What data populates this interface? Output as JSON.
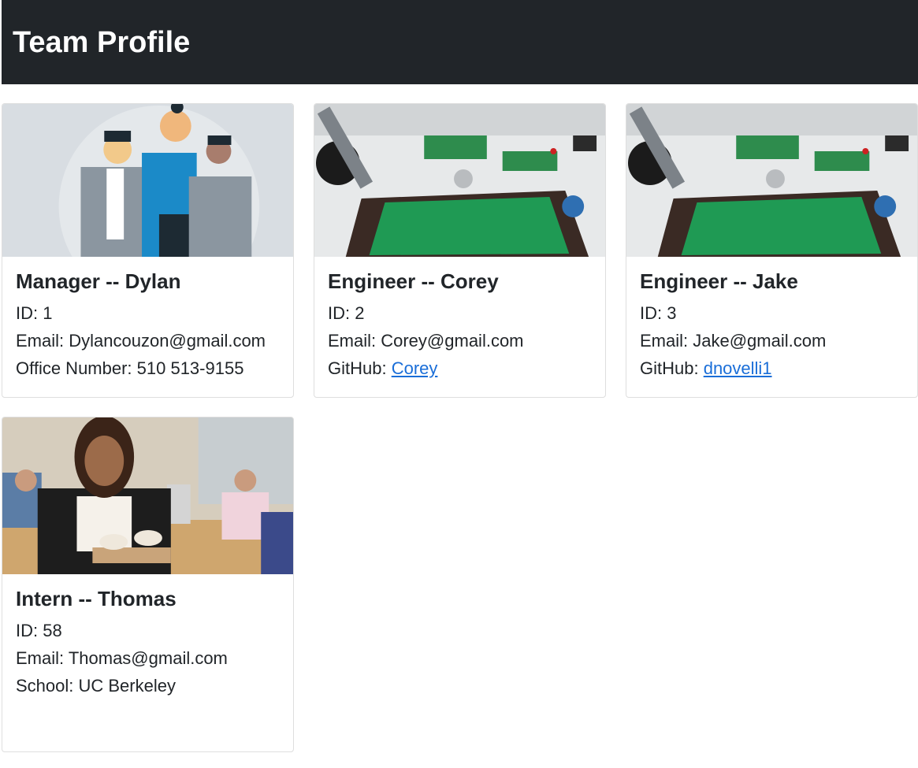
{
  "header": {
    "title": "Team Profile"
  },
  "cards": [
    {
      "image": "team-illustration",
      "title": "Manager -- Dylan",
      "id_label": "ID: 1",
      "email_label": "Email: Dylancouzon@gmail.com",
      "extra_label": "Office Number: 510 513-9155"
    },
    {
      "image": "circuit-board-photo",
      "title": "Engineer -- Corey",
      "id_label": "ID: 2",
      "email_label": "Email: Corey@gmail.com",
      "extra_prefix": "GitHub: ",
      "extra_link": "Corey"
    },
    {
      "image": "circuit-board-photo",
      "title": "Engineer -- Jake",
      "id_label": "ID: 3",
      "email_label": "Email: Jake@gmail.com",
      "extra_prefix": "GitHub: ",
      "extra_link": "dnovelli1"
    },
    {
      "image": "intern-office-photo",
      "title": "Intern -- Thomas",
      "id_label": "ID: 58",
      "email_label": "Email: Thomas@gmail.com",
      "extra_label": "School: UC Berkeley"
    }
  ],
  "colors": {
    "navbar": "#212529",
    "link": "#1a6ed8",
    "text": "#212529"
  }
}
